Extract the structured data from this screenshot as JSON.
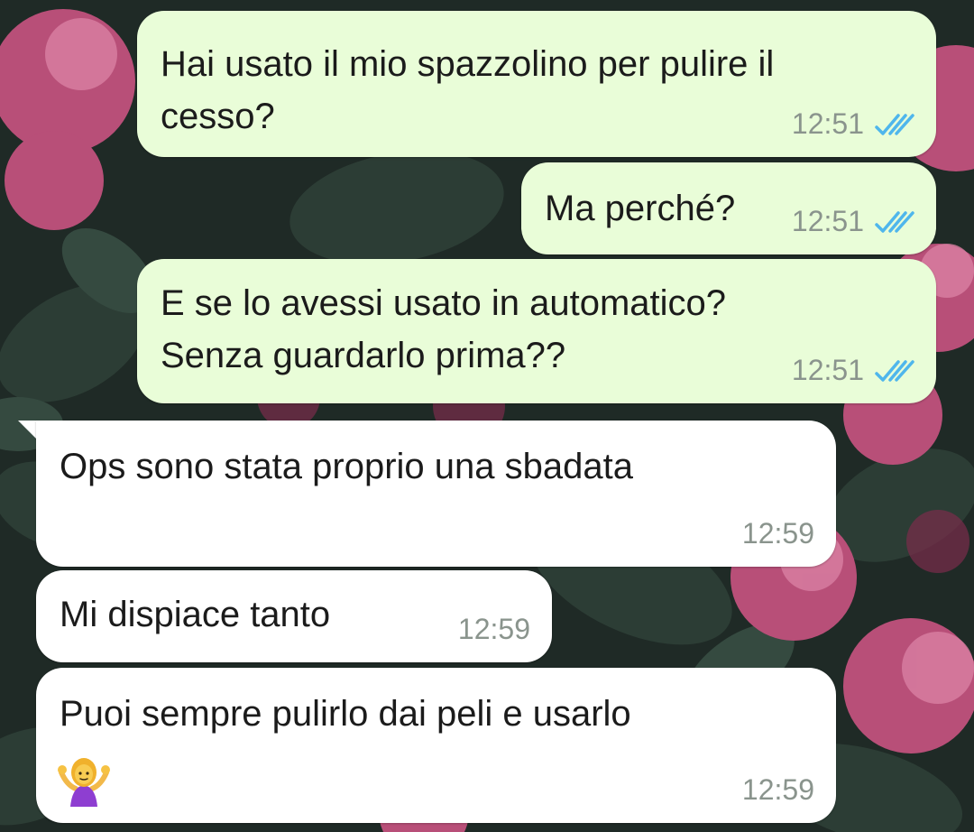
{
  "messages": [
    {
      "text": "Hai usato il mio spazzolino per pulire il\ncesso?",
      "time": "12:51",
      "direction": "outgoing",
      "status": "read"
    },
    {
      "text": "Ma perché?",
      "time": "12:51",
      "direction": "outgoing",
      "status": "read"
    },
    {
      "text": "E se lo avessi usato in automatico?\nSenza guardarlo prima??",
      "time": "12:51",
      "direction": "outgoing",
      "status": "read"
    },
    {
      "text": "Ops sono stata proprio una sbadata",
      "time": "12:59",
      "direction": "incoming"
    },
    {
      "text": "Mi dispiace tanto",
      "time": "12:59",
      "direction": "incoming"
    },
    {
      "text": "Puoi sempre pulirlo dai peli e usarlo",
      "time": "12:59",
      "direction": "incoming",
      "emoji": "person-shrugging-emoji"
    }
  ],
  "colors": {
    "outgoing_bubble": "#e9fdd8",
    "incoming_bubble": "#ffffff",
    "timestamp": "#8a948d",
    "read_ticks": "#4fb6ec"
  },
  "icons": {
    "read_receipt": "double-check-icon",
    "background": "floral-wallpaper"
  }
}
